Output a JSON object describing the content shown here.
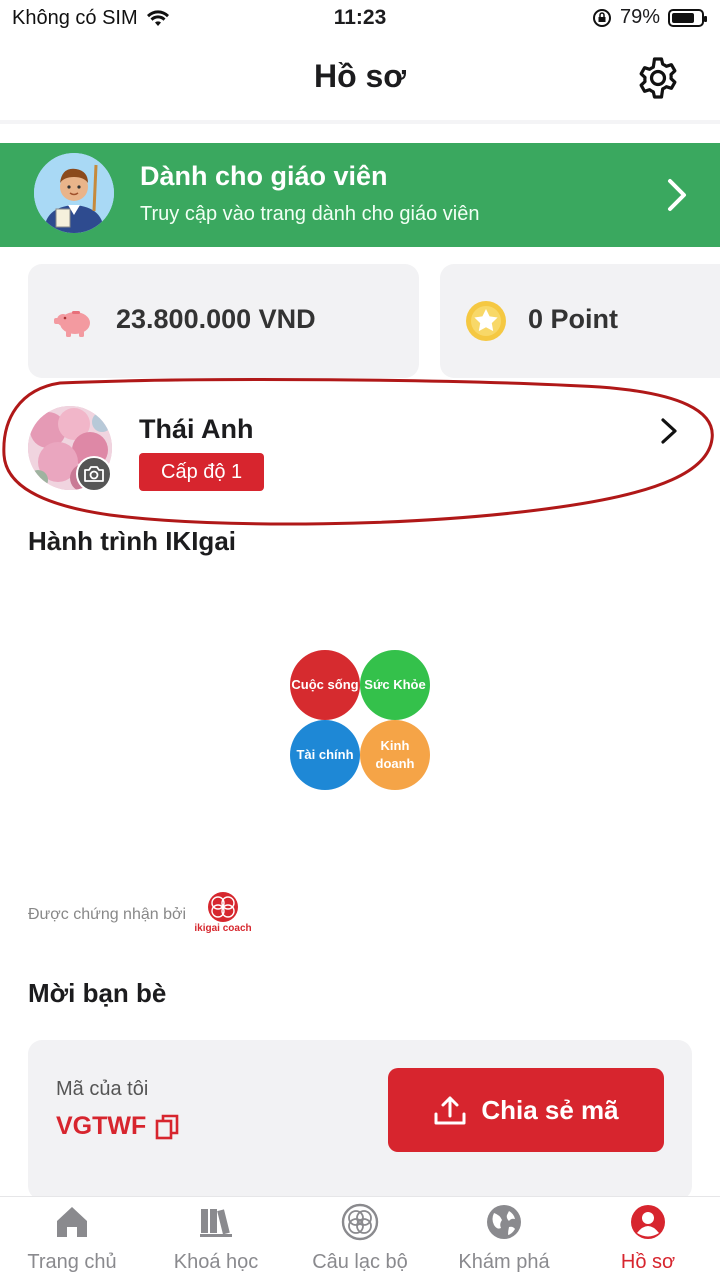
{
  "status_bar": {
    "carrier": "Không có SIM",
    "time": "11:23",
    "battery_percent": "79%",
    "battery_level": 0.79
  },
  "header": {
    "title": "Hồ sơ",
    "settings_icon": "gear-icon"
  },
  "teacher_banner": {
    "title": "Dành cho giáo viên",
    "subtitle": "Truy cập vào trang dành cho giáo viên",
    "bg_color": "#3aa85f"
  },
  "wallet": {
    "value": "23.800.000 VND",
    "icon": "piggy-bank-icon"
  },
  "points": {
    "value": "0 Point",
    "icon": "star-coin-icon"
  },
  "profile": {
    "name": "Thái Anh",
    "level": "Cấp độ 1"
  },
  "journey": {
    "title": "Hành trình IKIgai",
    "circles": {
      "life": "Cuộc sống",
      "health": "Sức Khỏe",
      "finance": "Tài chính",
      "business": "Kinh doanh"
    },
    "certified_by": "Được chứng nhận bởi",
    "logo_text": "ikigai coach"
  },
  "invite": {
    "title": "Mời bạn bè",
    "code_label": "Mã của tôi",
    "code": "VGTWF",
    "share_label": "Chia sẻ mã"
  },
  "tabs": [
    {
      "label": "Trang chủ",
      "icon": "home-icon"
    },
    {
      "label": "Khoá học",
      "icon": "books-icon"
    },
    {
      "label": "Câu lạc bộ",
      "icon": "club-icon"
    },
    {
      "label": "Khám phá",
      "icon": "globe-icon"
    },
    {
      "label": "Hồ sơ",
      "icon": "profile-icon"
    }
  ],
  "colors": {
    "accent": "#d7252e",
    "green": "#3aa85f",
    "annotation": "#b01818"
  }
}
